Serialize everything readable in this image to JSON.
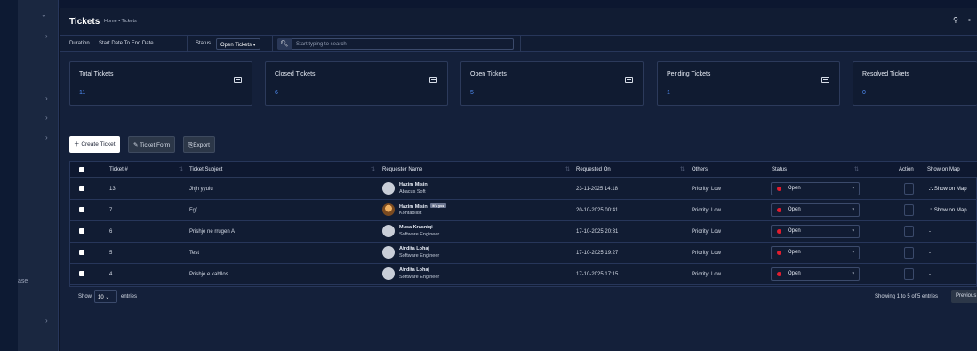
{
  "page": {
    "title": "Tickets",
    "breadcrumb": "Home • Tickets",
    "sidebar_fragment": "ase"
  },
  "filters": {
    "duration_label": "Duration",
    "date_range": "Start Date To End Date",
    "status_label": "Status",
    "status_value": "Open Tickets",
    "search_placeholder": "Start typing to search"
  },
  "cards": [
    {
      "title": "Total Tickets",
      "value": "11"
    },
    {
      "title": "Closed Tickets",
      "value": "6"
    },
    {
      "title": "Open Tickets",
      "value": "5"
    },
    {
      "title": "Pending Tickets",
      "value": "1"
    },
    {
      "title": "Resolved Tickets",
      "value": "0"
    }
  ],
  "actions": {
    "create": "Create Ticket",
    "form": "Ticket Form",
    "export": "Export"
  },
  "table": {
    "headers": [
      "Ticket #",
      "Ticket Subject",
      "Requester Name",
      "Requested On",
      "Others",
      "Status",
      "Action",
      "Show on Map"
    ],
    "rows": [
      {
        "id": "13",
        "subject": "Jhjh yyuiu",
        "req_name": "Hazim Misini",
        "req_role": "Abacus Soft",
        "req_badge": "",
        "requested_on": "23-11-2025 14:18",
        "others": "Priority: Low",
        "status": "Open",
        "map": "Show on Map"
      },
      {
        "id": "7",
        "subject": "Fgf",
        "req_name": "Hazim Misini",
        "req_role": "Kontabilist",
        "req_badge": "It's you",
        "requested_on": "20-10-2025 00:41",
        "others": "Priority: Low",
        "status": "Open",
        "map": "Show on Map"
      },
      {
        "id": "6",
        "subject": "Prishje ne rrugen A",
        "req_name": "Musa Krasniqi",
        "req_role": "Software Engineer",
        "req_badge": "",
        "requested_on": "17-10-2025 20:31",
        "others": "Priority: Low",
        "status": "Open",
        "map": "-"
      },
      {
        "id": "5",
        "subject": "Test",
        "req_name": "Afrdita Lohaj",
        "req_role": "Software Engineer",
        "req_badge": "",
        "requested_on": "17-10-2025 19:27",
        "others": "Priority: Low",
        "status": "Open",
        "map": "-"
      },
      {
        "id": "4",
        "subject": "Prishje e kabllos",
        "req_name": "Afrdita Lohaj",
        "req_role": "Software Engineer",
        "req_badge": "",
        "requested_on": "17-10-2025 17:15",
        "others": "Priority: Low",
        "status": "Open",
        "map": "-"
      }
    ]
  },
  "footer": {
    "show": "Show",
    "page_length": "10",
    "entries": "entries",
    "info": "Showing 1 to 5 of 5 entries",
    "previous": "Previous"
  },
  "colors": {
    "accent": "#4f8df5",
    "status_open": "#e11d2e"
  }
}
